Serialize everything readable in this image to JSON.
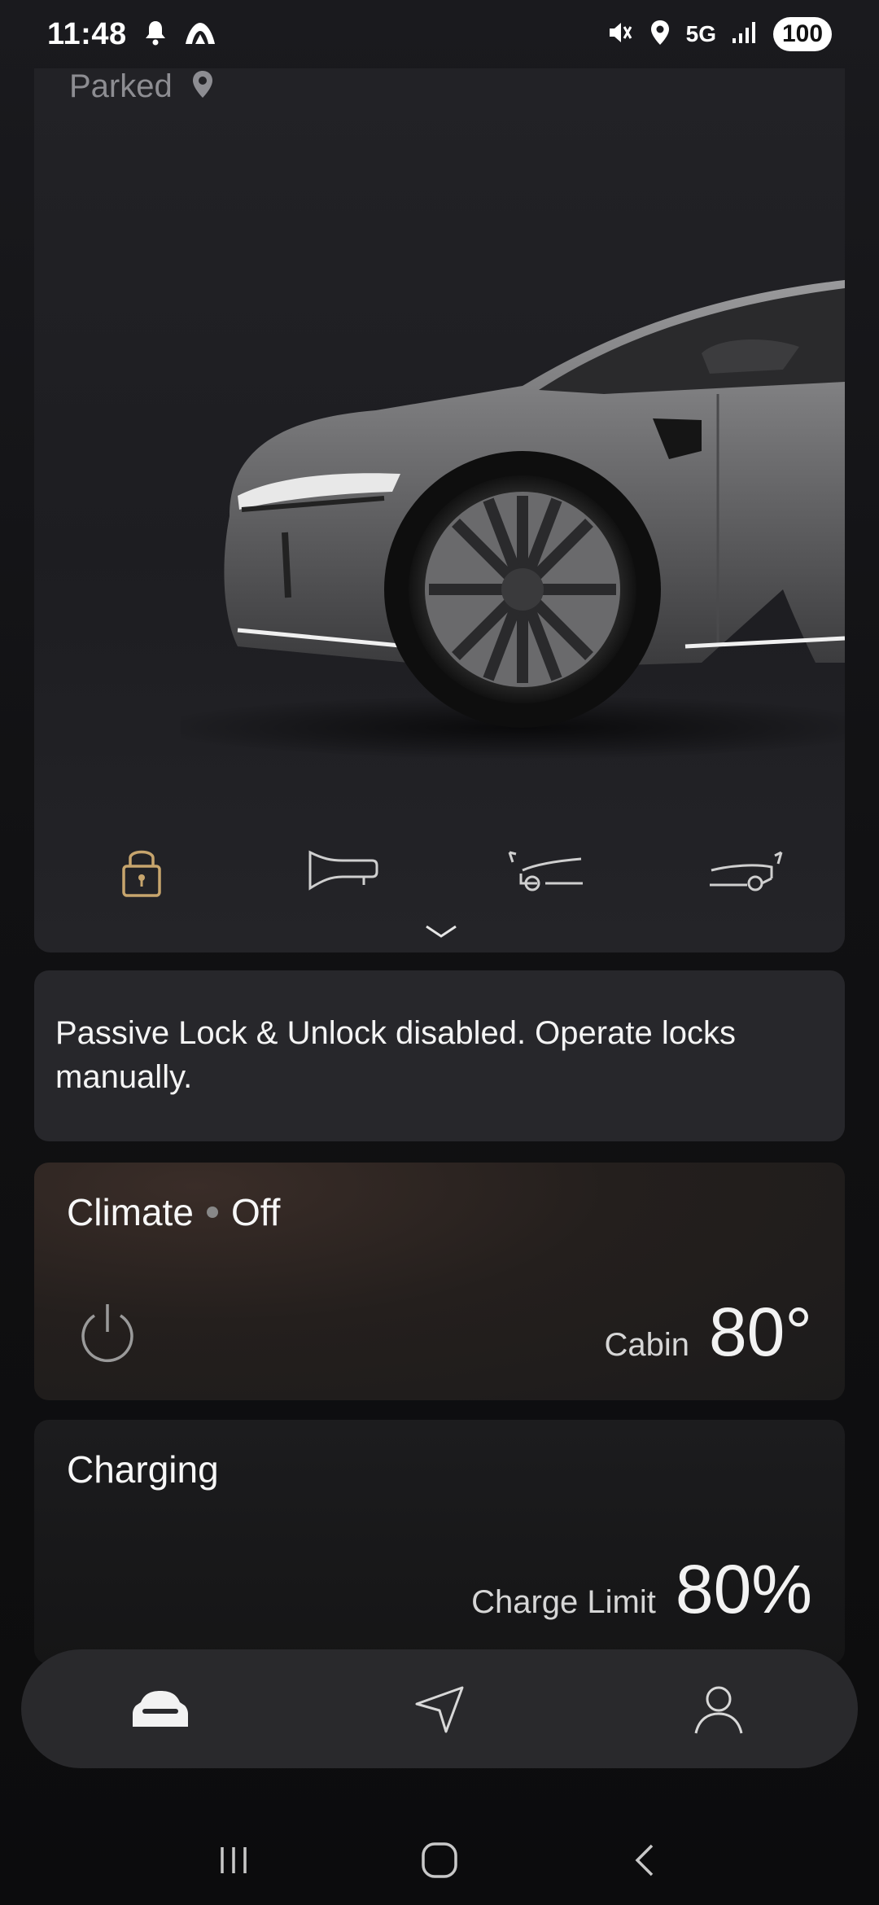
{
  "status_bar": {
    "time": "11:48",
    "network": "5G",
    "battery": "100",
    "icons": [
      "bell-icon",
      "app-notification-icon",
      "mute-icon",
      "location-icon",
      "signal-icon"
    ]
  },
  "car_card": {
    "status": "Parked",
    "status_icon": "location-pin-icon",
    "quick_actions": [
      "lock-icon",
      "horn-icon",
      "frunk-open-icon",
      "trunk-open-icon"
    ],
    "accent_color": "#c7a56d"
  },
  "notice": {
    "text": "Passive Lock & Unlock disabled. Operate locks manually."
  },
  "climate": {
    "title": "Climate",
    "state": "Off",
    "cabin_label": "Cabin",
    "cabin_temp": "80°"
  },
  "charging": {
    "title": "Charging",
    "limit_label": "Charge Limit",
    "limit_value": "80%"
  },
  "bottom_nav": {
    "items": [
      "car-icon",
      "navigation-icon",
      "profile-icon"
    ]
  },
  "system_nav": {
    "items": [
      "recents-icon",
      "home-icon",
      "back-icon"
    ]
  }
}
